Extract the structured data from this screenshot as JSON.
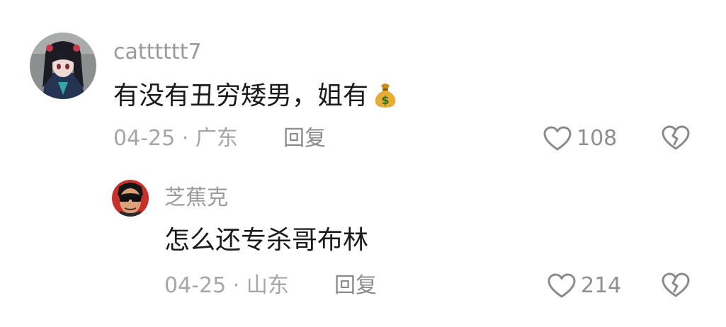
{
  "comments": [
    {
      "username": "catttttt7",
      "text": "有没有丑穷矮男，姐有",
      "text_emoji": "money-bag",
      "date": "04-25",
      "separator": "·",
      "location": "广东",
      "reply_label": "回复",
      "likes": "108",
      "avatar_icon": "anime-girl-avatar"
    },
    {
      "username": "芝蕉克",
      "text": "怎么还专杀哥布林",
      "date": "04-25",
      "separator": "·",
      "location": "山东",
      "reply_label": "回复",
      "likes": "214",
      "avatar_icon": "cartoon-man-sunglasses-avatar"
    }
  ],
  "colors": {
    "username": "#9a9a9a",
    "text": "#1a1a1a",
    "meta": "#a6a6a6",
    "icon": "#8a8a8a"
  }
}
